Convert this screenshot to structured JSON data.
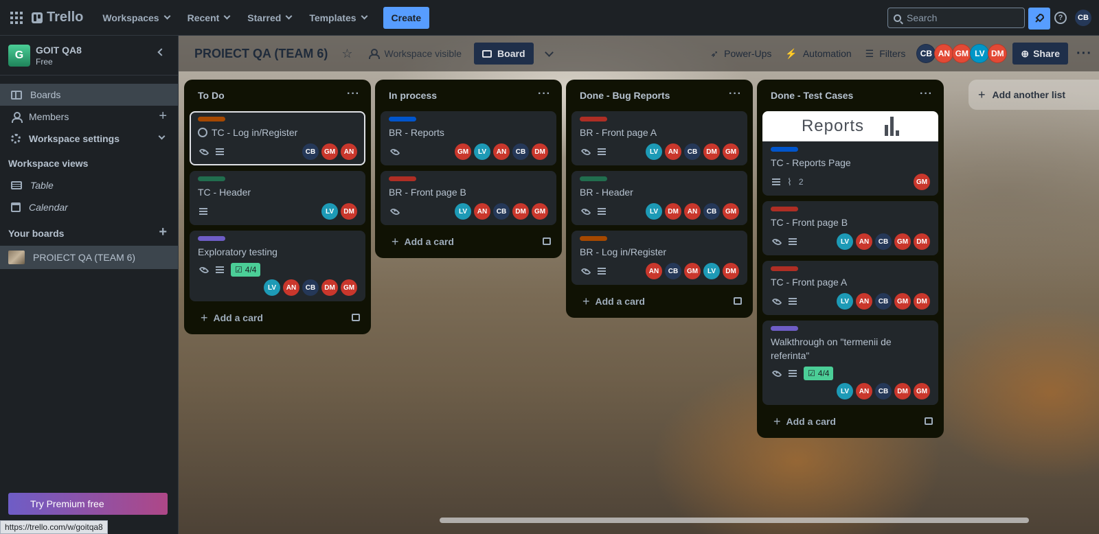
{
  "topbar": {
    "brand": "Trello",
    "nav": [
      "Workspaces",
      "Recent",
      "Starred",
      "Templates"
    ],
    "create_label": "Create",
    "search_placeholder": "Search",
    "help_label": "?",
    "user_initials": "CB"
  },
  "sidebar": {
    "workspace_initial": "G",
    "workspace_name": "GOIT QA8",
    "workspace_plan": "Free",
    "items": [
      {
        "label": "Boards"
      },
      {
        "label": "Members"
      },
      {
        "label": "Workspace settings"
      }
    ],
    "views_heading": "Workspace views",
    "views": [
      {
        "label": "Table"
      },
      {
        "label": "Calendar"
      }
    ],
    "boards_heading": "Your boards",
    "boards": [
      {
        "label": "PROIECT QA (TEAM 6)"
      }
    ],
    "premium_label": "Try Premium free"
  },
  "status_url": "https://trello.com/w/goitqa8",
  "board": {
    "title": "PROIECT QA (TEAM 6)",
    "visibility_label": "Workspace visible",
    "view_label": "Board",
    "powerups_label": "Power-Ups",
    "automation_label": "Automation",
    "filters_label": "Filters",
    "share_label": "Share",
    "members": [
      {
        "initials": "CB",
        "color": "#253858"
      },
      {
        "initials": "AN",
        "color": "#e34935"
      },
      {
        "initials": "GM",
        "color": "#e34935"
      },
      {
        "initials": "LV",
        "color": "#0096c7"
      },
      {
        "initials": "DM",
        "color": "#e34935"
      }
    ],
    "add_list_label": "Add another list"
  },
  "colors": {
    "CB": "#253858",
    "AN": "#c9372c",
    "GM": "#c9372c",
    "LV": "#1d9ab6",
    "DM": "#c9372c"
  },
  "lists": [
    {
      "title": "To Do",
      "add_label": "Add a card",
      "cards": [
        {
          "title": "TC - Log in/Register",
          "label_color": "#a54800",
          "checkbox": true,
          "watch": true,
          "desc": true,
          "members": [
            "CB",
            "GM",
            "AN"
          ],
          "selected": true
        },
        {
          "title": "TC - Header",
          "label_color": "#216e4e",
          "desc": true,
          "members": [
            "LV",
            "DM"
          ]
        },
        {
          "title": "Exploratory testing",
          "label_color": "#6e5dc6",
          "watch": true,
          "desc": true,
          "checklist": "4/4",
          "members": [
            "LV",
            "AN",
            "CB",
            "DM",
            "GM"
          ]
        }
      ]
    },
    {
      "title": "In process",
      "add_label": "Add a card",
      "cards": [
        {
          "title": "BR - Reports",
          "label_color": "#0055cc",
          "watch": true,
          "members": [
            "GM",
            "LV",
            "AN",
            "CB",
            "DM"
          ]
        },
        {
          "title": "BR - Front page B",
          "label_color": "#ae2e24",
          "watch": true,
          "members": [
            "LV",
            "AN",
            "CB",
            "DM",
            "GM"
          ]
        }
      ]
    },
    {
      "title": "Done - Bug Reports",
      "add_label": "Add a card",
      "cards": [
        {
          "title": "BR - Front page A",
          "label_color": "#ae2e24",
          "watch": true,
          "desc": true,
          "members": [
            "LV",
            "AN",
            "CB",
            "DM",
            "GM"
          ]
        },
        {
          "title": "BR - Header",
          "label_color": "#216e4e",
          "watch": true,
          "desc": true,
          "members": [
            "LV",
            "DM",
            "AN",
            "CB",
            "GM"
          ]
        },
        {
          "title": "BR - Log in/Register",
          "label_color": "#a54800",
          "watch": true,
          "desc": true,
          "members": [
            "AN",
            "CB",
            "GM",
            "LV",
            "DM"
          ]
        }
      ]
    },
    {
      "title": "Done - Test Cases",
      "add_label": "Add a card",
      "cards": [
        {
          "title": "TC - Reports Page",
          "label_color": "#0055cc",
          "cover_text": "Reports",
          "desc": true,
          "attachments": "2",
          "members": [
            "GM"
          ]
        },
        {
          "title": "TC - Front page B",
          "label_color": "#ae2e24",
          "watch": true,
          "desc": true,
          "members": [
            "LV",
            "AN",
            "CB",
            "GM",
            "DM"
          ]
        },
        {
          "title": "TC - Front page A",
          "label_color": "#ae2e24",
          "watch": true,
          "desc": true,
          "members": [
            "LV",
            "AN",
            "CB",
            "GM",
            "DM"
          ]
        },
        {
          "title": "Walkthrough on \"termenii de referinta\"",
          "label_color": "#6e5dc6",
          "watch": true,
          "desc": true,
          "checklist": "4/4",
          "members": [
            "LV",
            "AN",
            "CB",
            "DM",
            "GM"
          ]
        }
      ]
    }
  ]
}
